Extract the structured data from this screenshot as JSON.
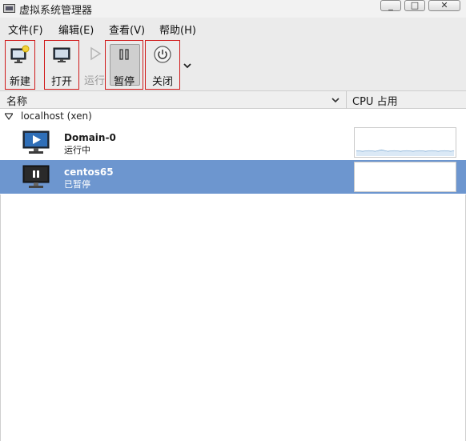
{
  "window": {
    "title": "虚拟系统管理器",
    "min_icon": "minimize-icon",
    "max_icon": "maximize-icon",
    "close_icon": "close-icon"
  },
  "menu": {
    "file": "文件(F)",
    "edit": "编辑(E)",
    "view": "查看(V)",
    "help": "帮助(H)"
  },
  "toolbar": {
    "new_label": "新建",
    "open_label": "打开",
    "run_label": "运行",
    "pause_label": "暂停",
    "shutdown_label": "关闭",
    "icons": [
      "new-vm-icon",
      "monitor-icon",
      "play-icon",
      "pause-icon",
      "power-icon",
      "chevron-down-icon"
    ]
  },
  "columns": {
    "name": "名称",
    "cpu": "CPU 占用"
  },
  "tree": {
    "host_label": "localhost (xen)",
    "vms": [
      {
        "name": "Domain-0",
        "status": "运行中",
        "state": "running",
        "icon": "play-screen-icon"
      },
      {
        "name": "centos65",
        "status": "已暂停",
        "state": "paused",
        "icon": "pause-screen-icon"
      }
    ]
  },
  "colors": {
    "selection": "#6d96cf",
    "highlight_box": "#d01a1a",
    "cpu_line": "#5a92c6"
  }
}
